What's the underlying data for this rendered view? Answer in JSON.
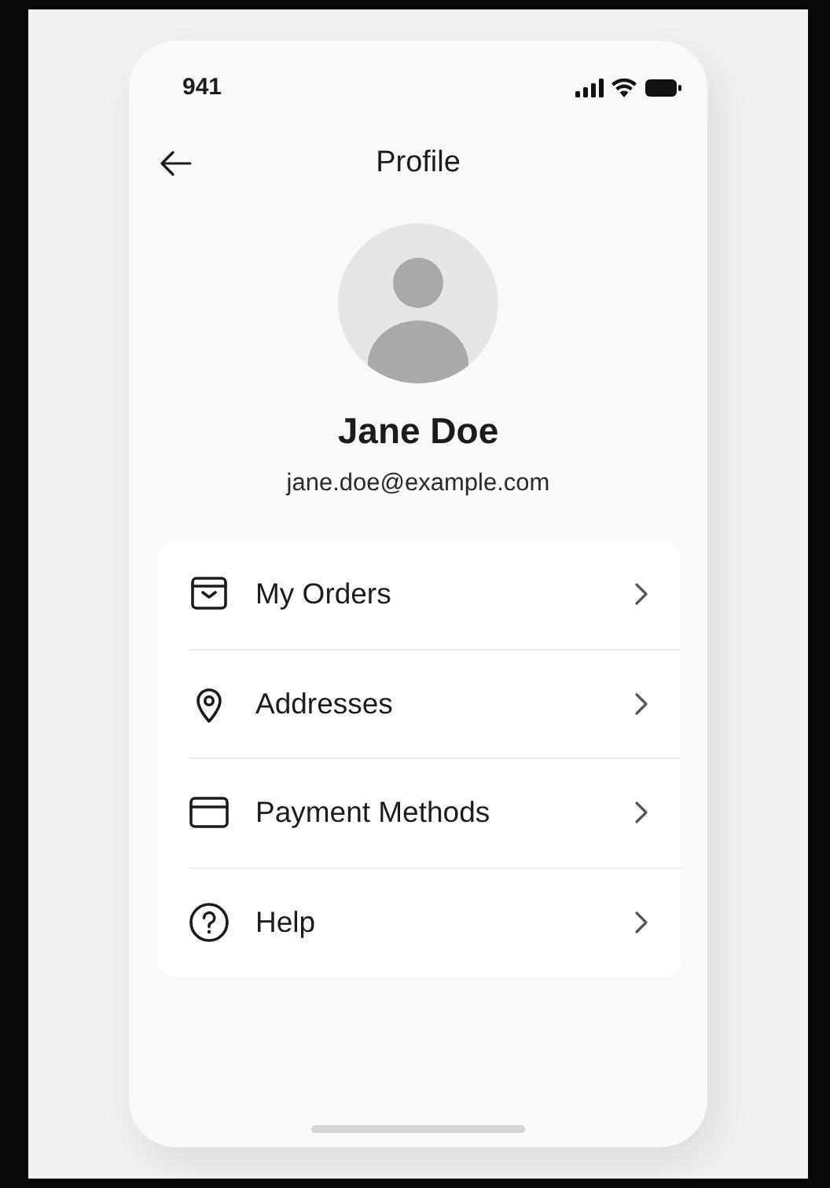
{
  "status_bar": {
    "time": "941"
  },
  "header": {
    "title": "Profile"
  },
  "profile": {
    "name": "Jane Doe",
    "email": "jane.doe@example.com"
  },
  "menu": [
    {
      "kind": "orders",
      "label": "My Orders"
    },
    {
      "kind": "address",
      "label": "Addresses"
    },
    {
      "kind": "payment",
      "label": "Payment Methods"
    },
    {
      "kind": "help",
      "label": "Help"
    }
  ]
}
